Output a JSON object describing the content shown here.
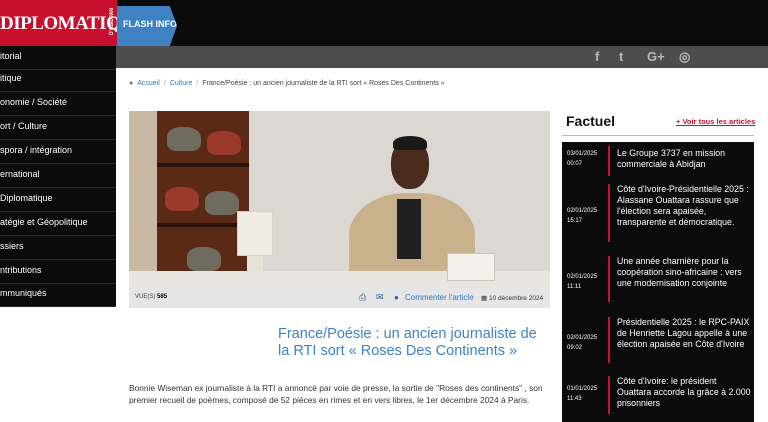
{
  "header": {
    "logo": "DIPLOMATIQUE",
    "logo_sub": "D'ABIDJAN",
    "flash_label": "FLASH INFO"
  },
  "sidebar": {
    "items": [
      {
        "label": "itorial"
      },
      {
        "label": "itique"
      },
      {
        "label": "onomie / Société"
      },
      {
        "label": "ort / Culture"
      },
      {
        "label": "spora / intégration"
      },
      {
        "label": "ernational"
      },
      {
        "label": "Diplomatique"
      },
      {
        "label": "atégie et Géopolitique"
      },
      {
        "label": "ssiers"
      },
      {
        "label": "ntributions"
      },
      {
        "label": "mmuniqués"
      }
    ]
  },
  "social": {
    "icons": [
      "facebook-icon",
      "twitter-icon",
      "google-plus-icon",
      "instagram-icon"
    ],
    "glyphs": [
      "f",
      "t",
      "G+",
      "◎"
    ]
  },
  "breadcrumb": {
    "home": "Accueil",
    "section": "Culture",
    "current": "France/Poésie : un ancien journaliste de la RTI sort « Roses Des Continents »"
  },
  "article": {
    "views_label": "VUE(S)",
    "views": "585",
    "comment_label": "Commenter l'article",
    "date": "10 décembre 2024",
    "headline": "France/Poésie : un ancien journaliste de la RTI sort « Roses Des Continents »",
    "body": "Bonnie Wiseman ex journaliste à la RTI a annoncé par voie de presse, la sortie de \"Roses des continents\" , son premier recueil de poèmes, composé de 52 pièces en rimes et en vers libres, le 1er décembre 2024 à Paris."
  },
  "factuel": {
    "title": "Factuel",
    "see_all": "+ Voir tous les articles",
    "items": [
      {
        "date": "03/01/2025",
        "time": "00:07",
        "text": "Le Groupe 3737 en mission commerciale à Abidjan"
      },
      {
        "date": "02/01/2025",
        "time": "15:17",
        "text": "Côte d'Ivoire-Présidentielle 2025 : Alassane Ouattara rassure que l'élection sera apaisée, transparente et démocratique."
      },
      {
        "date": "02/01/2025",
        "time": "11:11",
        "text": "Une année charnière pour la coopération sino-africaine : vers une modernisation conjointe"
      },
      {
        "date": "02/01/2025",
        "time": "09:02",
        "text": "Présidentielle 2025 : le RPC-PAIX de Henriette Lagou appelle à une élection apaisée en Côte d'Ivoire"
      },
      {
        "date": "01/01/2025",
        "time": "11:43",
        "text": "Côte d'Ivoire: le président Ouattara accorde la grâce à 2.000 prisonniers"
      }
    ]
  },
  "colors": {
    "brand_red": "#c8102e",
    "flash_blue": "#3e82c4",
    "link_blue": "#2f78c2",
    "dark": "#0b0b0b"
  }
}
